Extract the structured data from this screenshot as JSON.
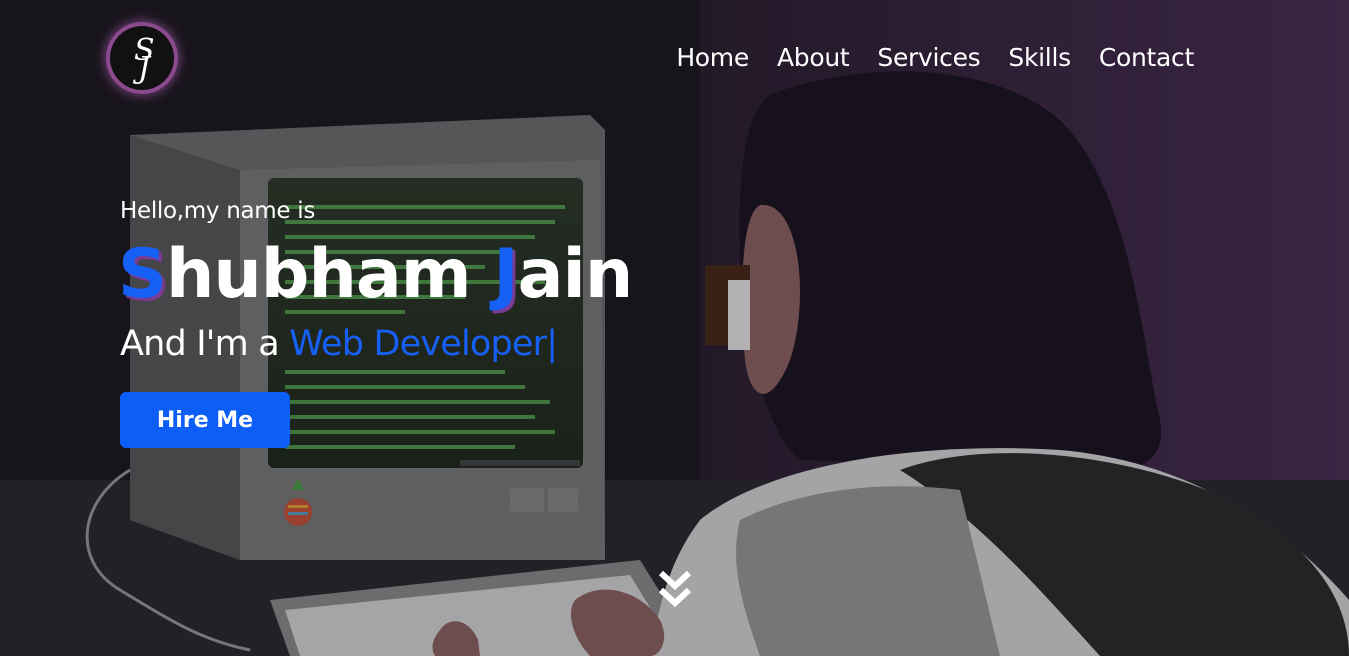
{
  "brand": {
    "logo_text": "SJ"
  },
  "nav": {
    "items": [
      {
        "label": "Home"
      },
      {
        "label": "About"
      },
      {
        "label": "Services"
      },
      {
        "label": "Skills"
      },
      {
        "label": "Contact"
      }
    ]
  },
  "hero": {
    "intro": "Hello,my name is",
    "name_first_initial": "S",
    "name_first_rest": "hubham",
    "name_last_initial": "J",
    "name_last_rest": "ain",
    "role_prefix": "And I'm a",
    "role_typed": "Web Developer",
    "cursor": "|",
    "hire_button": "Hire Me"
  },
  "icons": {
    "scroll": "double-chevron-down-icon",
    "logo": "sj-monogram-icon"
  },
  "colors": {
    "accent": "#0d5ef5",
    "initial_shadow": "#7a3b95",
    "logo_ring": "#8a4a8d",
    "text": "#ffffff"
  }
}
